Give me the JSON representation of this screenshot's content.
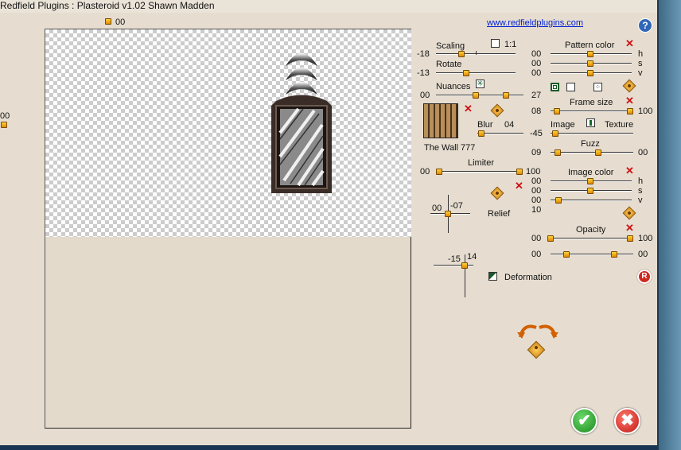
{
  "window": {
    "title": "Redfield Plugins : Plasteroid v1.02   Shawn Madden"
  },
  "link": "www.redfieldplugins.com",
  "help_glyph": "?",
  "reset_glyph": "R",
  "top_slider": {
    "value": "00"
  },
  "left_slider": {
    "value": "00"
  },
  "scaling": {
    "label": "Scaling",
    "value": "-18",
    "ratio_label": "1:1"
  },
  "rotate": {
    "label": "Rotate",
    "value": "-13"
  },
  "nuances": {
    "label": "Nuances",
    "min": "00",
    "max": "27"
  },
  "texture": {
    "name": "The Wall 777"
  },
  "blur": {
    "label": "Blur",
    "value": "04",
    "min": "-45"
  },
  "limiter": {
    "label": "Limiter",
    "min": "00",
    "max": "100"
  },
  "relief": {
    "label": "Relief",
    "x": "00",
    "y": "-07"
  },
  "deformation": {
    "label": "Deformation",
    "x": "-15",
    "y": "14"
  },
  "pattern_color": {
    "label": "Pattern color",
    "h": "00",
    "s": "00",
    "v": "00",
    "h_label": "h",
    "s_label": "s",
    "v_label": "v"
  },
  "frame_size": {
    "label": "Frame size",
    "min": "08",
    "max": "100"
  },
  "image_texture": {
    "image_label": "Image",
    "texture_label": "Texture"
  },
  "fuzz": {
    "label": "Fuzz",
    "min": "09",
    "max": "00"
  },
  "image_color": {
    "label": "Image color",
    "h": "00",
    "s": "00",
    "v": "00",
    "extra": "10",
    "h_label": "h",
    "s_label": "s",
    "v_label": "v"
  },
  "opacity": {
    "label": "Opacity",
    "min": "00",
    "max": "100",
    "bottom_left": "00",
    "bottom_right": "00"
  },
  "colors": {
    "knob": "#f0a000",
    "bg": "#e6ddd0",
    "ok": "#2aa02a",
    "cancel": "#d02020"
  }
}
